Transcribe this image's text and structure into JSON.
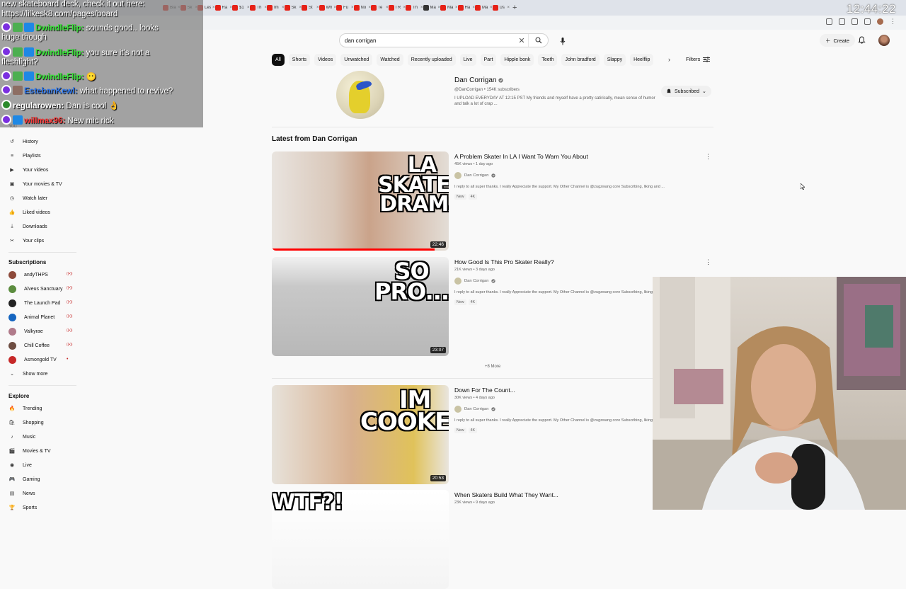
{
  "browser": {
    "clock": "12:44:22",
    "tabs": [
      "Bla",
      "Sk",
      "Les",
      "Ra",
      "$1",
      "Th",
      "Im",
      "Sk",
      "St",
      "Wh",
      "Fu",
      "No",
      "Te",
      "I R",
      "Th",
      "Ma",
      "Ma",
      "Ha",
      "Ma",
      "Us"
    ]
  },
  "header": {
    "search_value": "dan corrigan",
    "create_label": "Create"
  },
  "chips": [
    "All",
    "Shorts",
    "Videos",
    "Unwatched",
    "Watched",
    "Recently uploaded",
    "Live",
    "Part",
    "Hipple bonk",
    "Teeth",
    "John bradford",
    "Slappy",
    "Heelflip"
  ],
  "filters_label": "Filters",
  "channel": {
    "name": "Dan Corrigan",
    "handle_subs": "@DanCorrigan • 154K subscribers",
    "description": "I UPLOAD EVERYDAY AT 12:15 PST My friends and myself have a pretty satirically, mean sense of humor and talk a lot of crap ...",
    "subscribed_label": "Subscribed"
  },
  "section_title": "Latest from Dan Corrigan",
  "more_label": "+8 More",
  "videos": [
    {
      "title": "A Problem Skater In LA I Want To Warn You About",
      "meta": "45K views • 1 day ago",
      "channel": "Dan Corrigan",
      "desc": "I reply to all super thanks. I really Appreciate the support. My Other Channel is @zugzwang core Subscribing, liking and ...",
      "badges": [
        "New",
        "4K"
      ],
      "duration": "22:46",
      "thumb_text": "LA\nSKATER\nDRAMA",
      "progress": 0.92
    },
    {
      "title": "How Good Is This Pro Skater Really?",
      "meta": "21K views • 3 days ago",
      "channel": "Dan Corrigan",
      "desc": "I reply to all super thanks. I really Appreciate the support. My Other Channel is @zugzwang core Subscribing, liking and ...",
      "badges": [
        "New",
        "4K"
      ],
      "duration": "23:07",
      "thumb_text": "SO\nPRO...",
      "progress": 0
    },
    {
      "title": "Down For The Count...",
      "meta": "30K views • 4 days ago",
      "channel": "Dan Corrigan",
      "desc": "I reply to all super thanks. I really Appreciate the support. My Other Channel is @zugzwang core Subscribing, liking and ...",
      "badges": [
        "New",
        "4K"
      ],
      "duration": "20:53",
      "thumb_text": "IM\nCOOKED",
      "progress": 0
    },
    {
      "title": "When Skaters Build What They Want...",
      "meta": "23K views • 9 days ago",
      "channel": "",
      "desc": "",
      "badges": [],
      "duration": "",
      "thumb_text": "WTF?!",
      "progress": 0
    }
  ],
  "sidebar": {
    "you_label": "You",
    "you_items": [
      "History",
      "Playlists",
      "Your videos",
      "Your movies & TV",
      "Watch later",
      "Liked videos",
      "Downloads",
      "Your clips"
    ],
    "subscriptions_label": "Subscriptions",
    "subscriptions": [
      {
        "name": "andyTHPS",
        "color": "#8d4a3a",
        "live": true
      },
      {
        "name": "Alveus Sanctuary",
        "color": "#5b8c3e",
        "live": true
      },
      {
        "name": "The Launch Pad",
        "color": "#222222",
        "live": true
      },
      {
        "name": "Animal Planet",
        "color": "#1565c0",
        "live": true
      },
      {
        "name": "Valkyrae",
        "color": "#b07a8a",
        "live": true
      },
      {
        "name": "Chill Coffee",
        "color": "#6d4c41",
        "live": true
      },
      {
        "name": "Asmongold TV",
        "color": "#c62828",
        "live": false
      }
    ],
    "show_more": "Show more",
    "explore_label": "Explore",
    "explore_items": [
      "Trending",
      "Shopping",
      "Music",
      "Movies & TV",
      "Live",
      "Gaming",
      "News",
      "Sports"
    ]
  },
  "chat": [
    {
      "user": "",
      "text": "new skateboard deck, check it out here:"
    },
    {
      "user": "",
      "text": "https://lilkesk8.com/pages/board"
    },
    {
      "user": "DwindleFlip:",
      "text": "sounds good.. looks"
    },
    {
      "user": "",
      "text": "huge though"
    },
    {
      "user": "DwindleFlip:",
      "text": "you sure it's not a"
    },
    {
      "user": "",
      "text": "fleshlight?"
    },
    {
      "user": "DwindleFlip:",
      "text": "😶"
    },
    {
      "user": "EstebanKewl:",
      "text": "what happened to revive?"
    },
    {
      "user": "regularowen:",
      "text": "Dan is cool 👌"
    },
    {
      "user": "willmax96:",
      "text": "New mic rick"
    }
  ],
  "colors": {
    "brand_red": "#ff0000",
    "chat_name_green": "#39e639",
    "chat_name_blue": "#2f7bf5",
    "chat_name_red": "#ff3b3b"
  }
}
